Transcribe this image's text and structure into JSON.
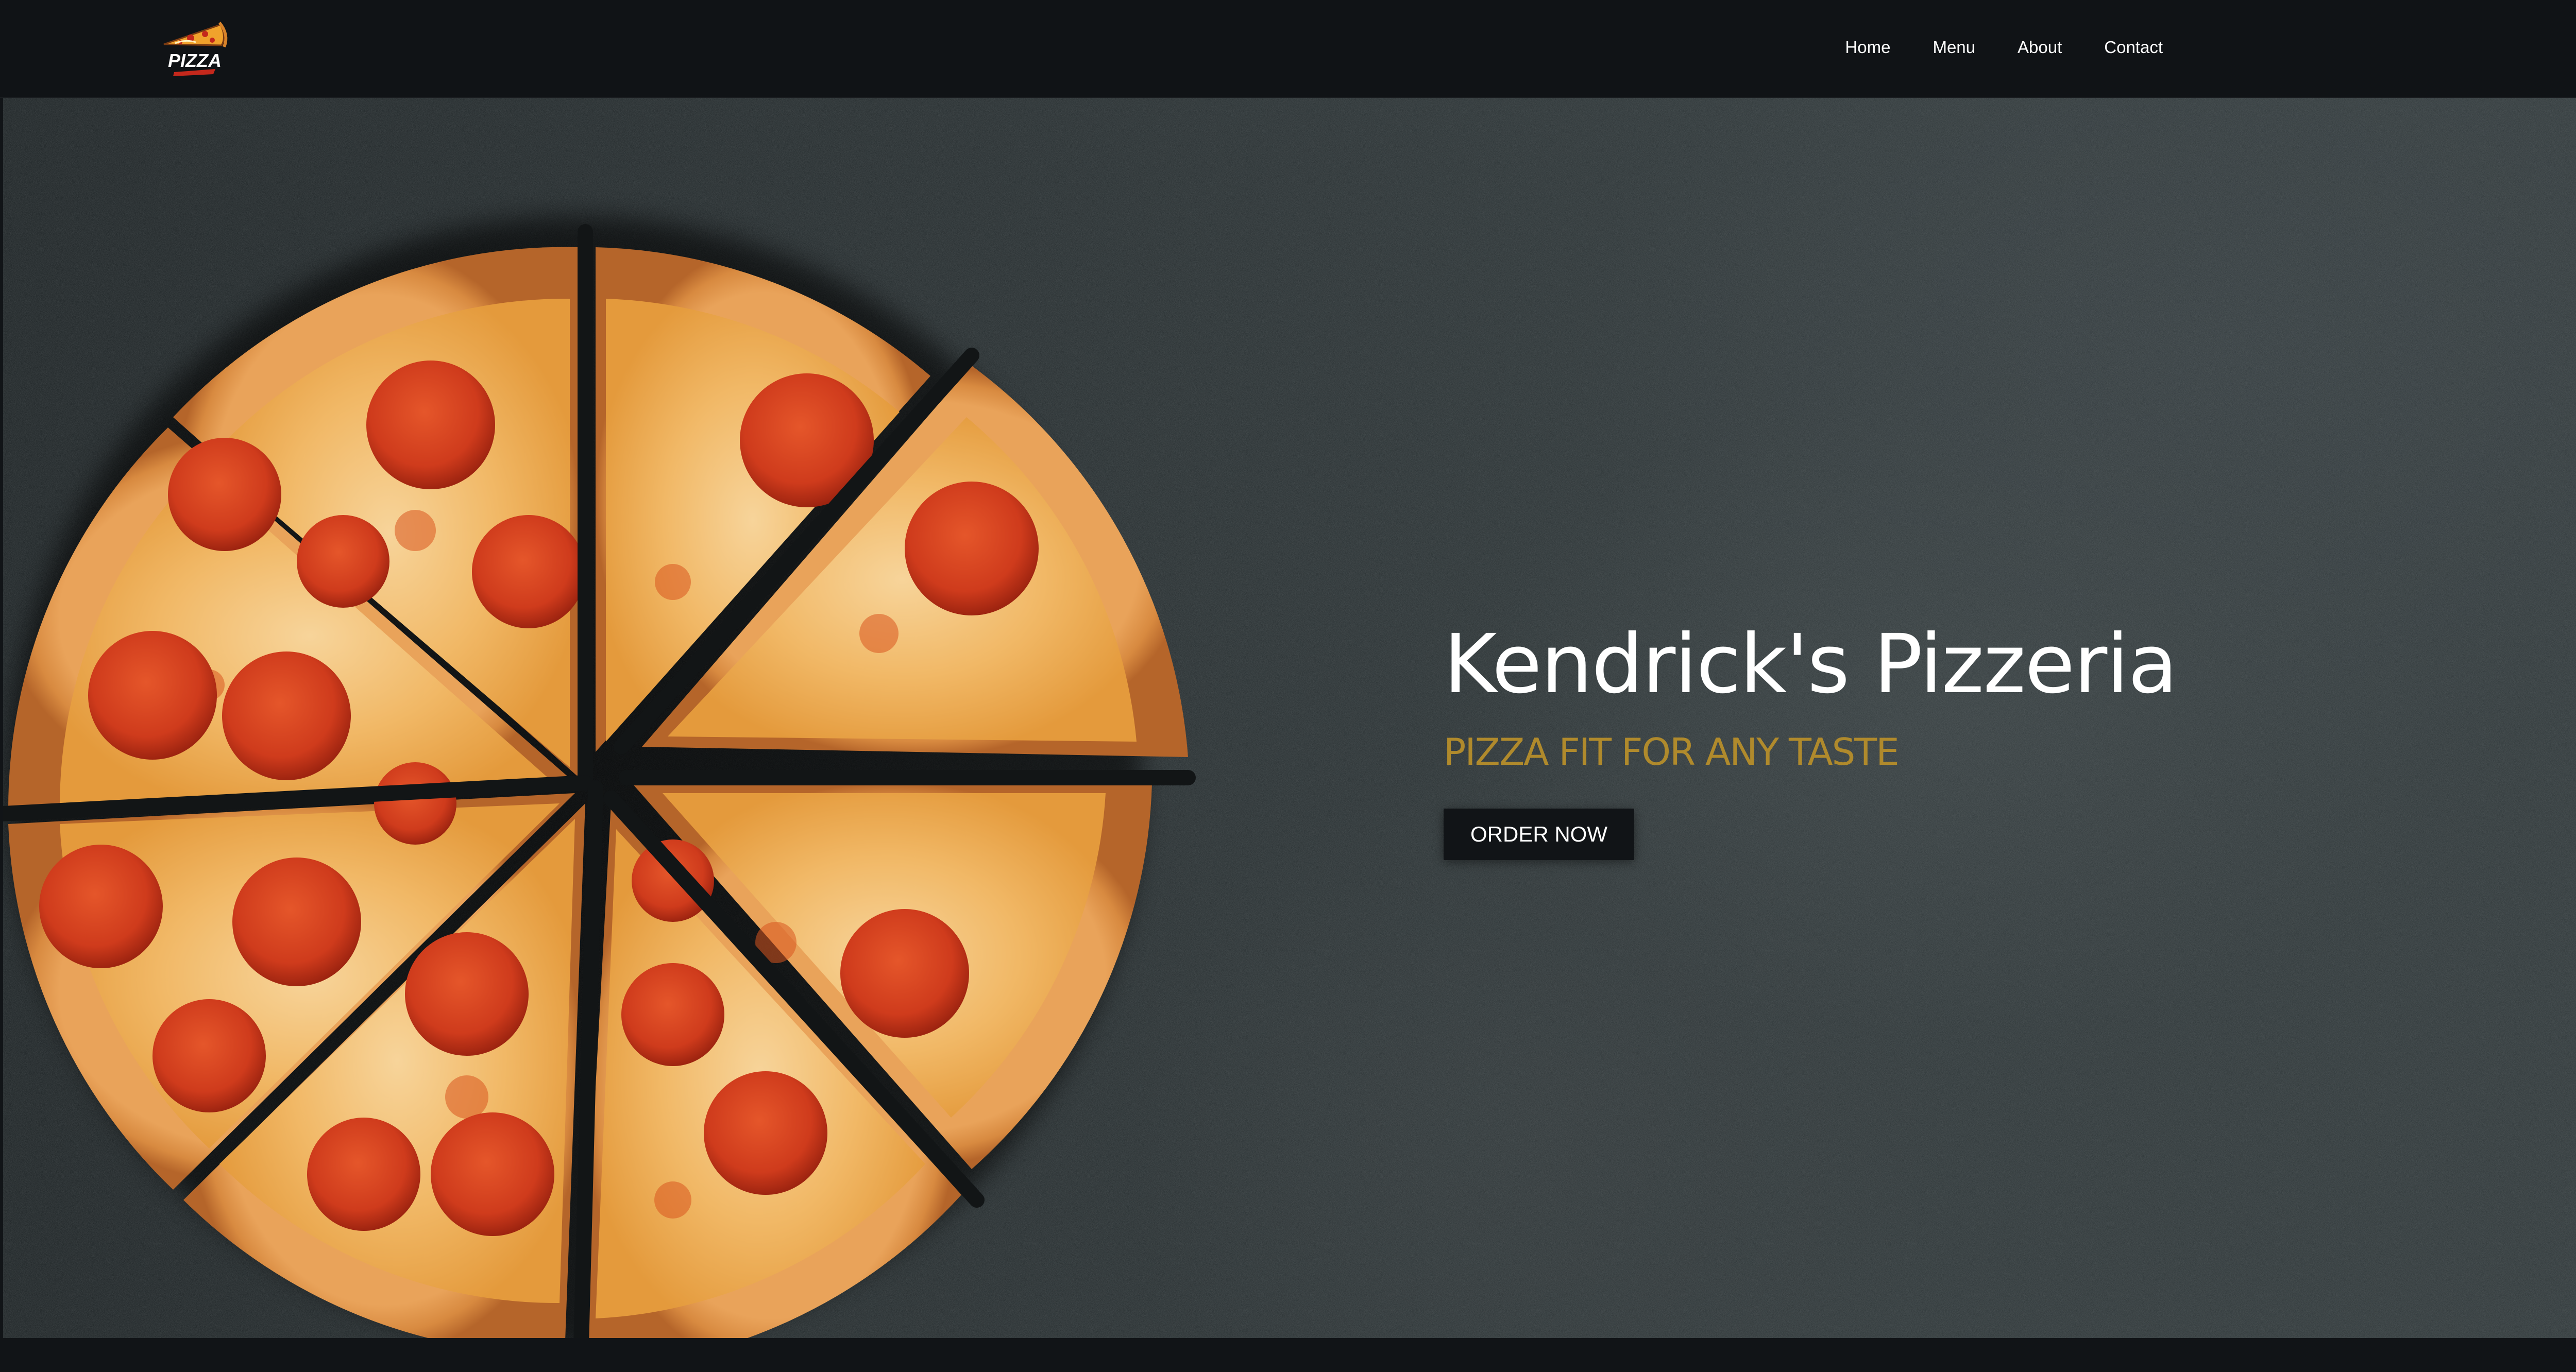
{
  "brand": {
    "logo_text": "PIZZA",
    "logo_icon": "pizza-slice-icon"
  },
  "nav": {
    "items": [
      {
        "label": "Home"
      },
      {
        "label": "Menu"
      },
      {
        "label": "About"
      },
      {
        "label": "Contact"
      }
    ]
  },
  "hero": {
    "title": "Kendrick's Pizzeria",
    "subtitle": "PIZZA FIT FOR ANY TASTE",
    "cta_label": "ORDER NOW",
    "image": "pepperoni-pizza-image"
  },
  "colors": {
    "page_bg": "#111417",
    "navbar_bg": "#101316",
    "subtitle_gold": "#b08a2c",
    "button_bg": "#111417",
    "text_white": "#ffffff"
  }
}
